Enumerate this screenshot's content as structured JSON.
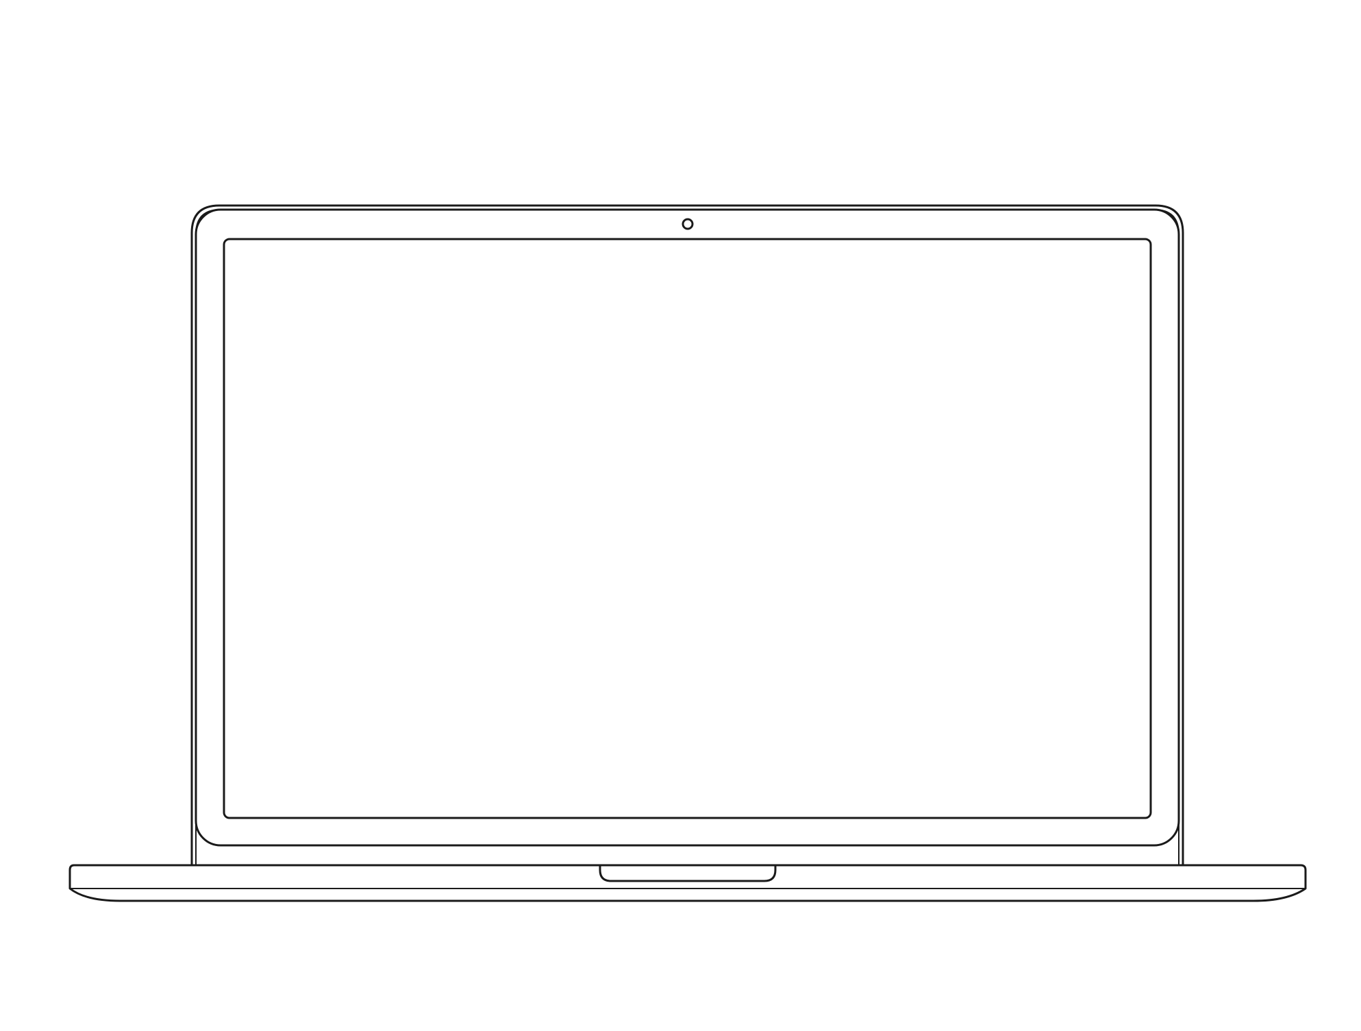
{
  "illustration": {
    "subject": "laptop-outline",
    "colors": {
      "background": "#ffffff",
      "stroke": "#1a1a1a",
      "screen_fill": "#ffffff"
    },
    "icons": [
      "webcam-icon"
    ]
  }
}
